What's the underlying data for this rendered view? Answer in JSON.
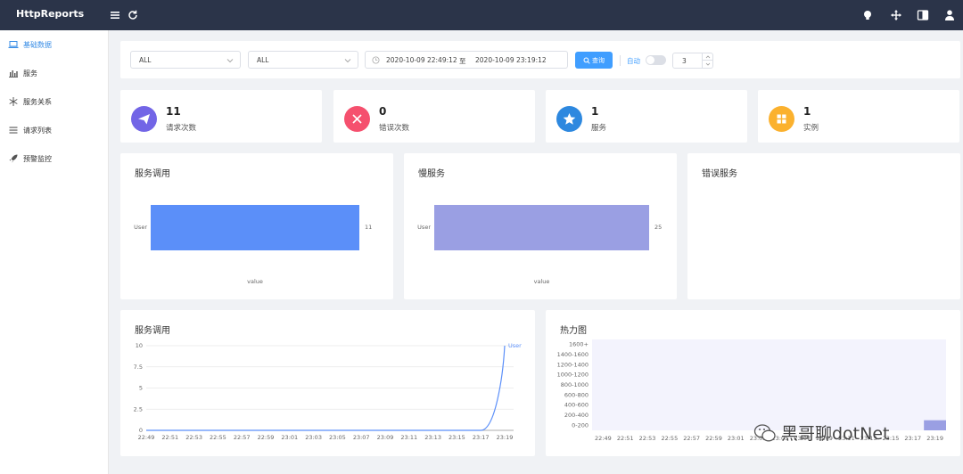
{
  "app": {
    "brand": "HttpReports"
  },
  "sidebar": {
    "items": [
      {
        "label": "基础数据",
        "icon": "laptop-icon",
        "active": true
      },
      {
        "label": "服务",
        "icon": "bar-chart-icon",
        "active": false
      },
      {
        "label": "服务关系",
        "icon": "snowflake-icon",
        "active": false
      },
      {
        "label": "请求列表",
        "icon": "list-icon",
        "active": false
      },
      {
        "label": "预警监控",
        "icon": "rocket-icon",
        "active": false
      }
    ]
  },
  "filters": {
    "service_select": "ALL",
    "instance_select": "ALL",
    "start_time": "2020-10-09 22:49:12",
    "range_separator": "至",
    "end_time": "2020-10-09 23:19:12",
    "query_button": "查询",
    "auto_label": "自动",
    "auto_enabled": false,
    "interval_value": "3"
  },
  "stats": [
    {
      "value": "11",
      "label": "请求次数",
      "color": "#7265e6",
      "icon": "paper-plane-icon"
    },
    {
      "value": "0",
      "label": "错误次数",
      "color": "#f5506e",
      "icon": "close-icon"
    },
    {
      "value": "1",
      "label": "服务",
      "color": "#2d88df",
      "icon": "star-icon"
    },
    {
      "value": "1",
      "label": "实例",
      "color": "#fbb12e",
      "icon": "grid-icon"
    }
  ],
  "panels": {
    "service_calls": {
      "title": "服务调用",
      "xlabel": "value"
    },
    "slow_services": {
      "title": "慢服务",
      "xlabel": "value"
    },
    "error_services": {
      "title": "错误服务"
    },
    "service_calls_trend": {
      "title": "服务调用"
    },
    "heatmap": {
      "title": "热力图"
    }
  },
  "chart_data": [
    {
      "type": "bar",
      "title": "服务调用",
      "orientation": "horizontal",
      "categories": [
        "User"
      ],
      "values": [
        11
      ],
      "xlabel": "value",
      "color": "#5b8ff9"
    },
    {
      "type": "bar",
      "title": "慢服务",
      "orientation": "horizontal",
      "categories": [
        "User"
      ],
      "values": [
        25
      ],
      "xlabel": "value",
      "color": "#9a9fe3"
    },
    {
      "type": "line",
      "title": "服务调用",
      "x": [
        "22:49",
        "22:51",
        "22:53",
        "22:55",
        "22:57",
        "22:59",
        "23:01",
        "23:03",
        "23:05",
        "23:07",
        "23:09",
        "23:11",
        "23:13",
        "23:15",
        "23:17",
        "23:19"
      ],
      "series": [
        {
          "name": "User",
          "values": [
            0,
            0,
            0,
            0,
            0,
            0,
            0,
            0,
            0,
            0,
            0,
            0,
            0,
            0,
            0,
            10
          ]
        }
      ],
      "ylim": [
        0,
        10
      ],
      "yticks": [
        "0",
        "2.5",
        "5",
        "7.5",
        "10"
      ],
      "grid": true,
      "legend": "top-right",
      "color": "#5b8ff9"
    },
    {
      "type": "heatmap",
      "title": "热力图",
      "x": [
        "22:49",
        "22:51",
        "22:53",
        "22:55",
        "22:57",
        "22:59",
        "23:01",
        "23:03",
        "23:05",
        "23:07",
        "23:09",
        "23:11",
        "23:13",
        "23:15",
        "23:17",
        "23:19"
      ],
      "y": [
        "0-200",
        "200-400",
        "400-600",
        "600-800",
        "800-1000",
        "1000-1200",
        "1200-1400",
        "1400-1600",
        "1600+"
      ],
      "cells": [
        {
          "x": "23:19",
          "y": "0-200",
          "value": 1
        }
      ],
      "background": "#f3f3fd",
      "cell_color": "#9a9fe3"
    }
  ],
  "watermark": {
    "text": "黑哥聊dotNet"
  }
}
